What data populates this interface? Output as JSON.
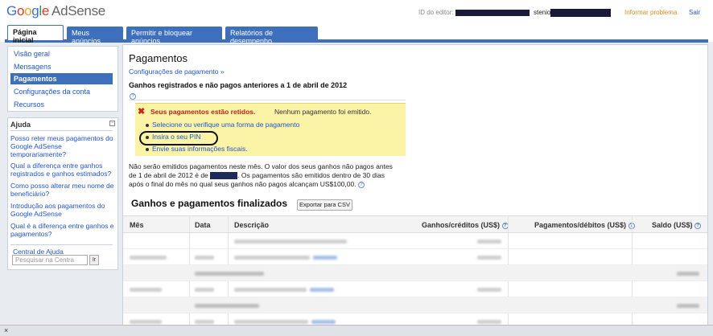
{
  "header": {
    "logo_google": [
      "G",
      "o",
      "o",
      "g",
      "l",
      "e"
    ],
    "logo_product": "AdSense",
    "publisher_label": "ID do editor:",
    "user_prefix": "stenio",
    "report_problem": "Informar problema",
    "logout": "Sair"
  },
  "tabs": [
    {
      "label": "Página inicial",
      "active": true
    },
    {
      "label": "Meus anúncios"
    },
    {
      "label": "Permitir e bloquear anúncios"
    },
    {
      "label": "Relatórios de desempenho"
    }
  ],
  "sidebar": {
    "items": [
      {
        "label": "Visão geral"
      },
      {
        "label": "Mensagens"
      },
      {
        "label": "Pagamentos",
        "selected": true
      },
      {
        "label": "Configurações da conta"
      },
      {
        "label": "Recursos"
      }
    ],
    "help": {
      "title": "Ajuda",
      "toggle": "−",
      "links": [
        "Posso reter meus pagamentos do Google AdSense temporariamente?",
        "Qual a diferença entre ganhos registrados e ganhos estimados?",
        "Como posso alterar meu nome de beneficiário?",
        "Introdução aos pagamentos do Google AdSense",
        "Qual é a diferença entre ganhos e pagamentos?"
      ],
      "help_center": "Central de Ajuda",
      "search_placeholder": "Pesquisar na Centra",
      "search_button": "Ir"
    }
  },
  "main": {
    "title": "Pagamentos",
    "config_link": "Configurações de pagamento »",
    "earnings_heading": "Ganhos registrados e não pagos anteriores a 1 de abril de 2012",
    "help_icon": "?",
    "warning": {
      "icon": "✖",
      "title": "Seus pagamentos estão retidos.",
      "rest": "Nenhum pagamento foi emitido.",
      "links": [
        "Selecione ou verifique uma forma de pagamento",
        "Insira o seu PIN",
        "Envie suas informações fiscais."
      ]
    },
    "notice_line1": "Não serão emitidos pagamentos neste mês. O valor dos seus ganhos não pagos antes",
    "notice_line2a": "de 1 de abril de 2012 é de",
    "notice_line2b": ". Os pagamentos são emitidos dentro de 30 dias",
    "notice_line3": "após o final do mês no qual seus ganhos não pagos alcançam US$100,00.",
    "final_heading": "Ganhos e pagamentos finalizados",
    "export_button": "Exportar para CSV",
    "table": {
      "columns": [
        "Mês",
        "Data",
        "Descrição",
        "Ganhos/créditos (US$)",
        "Pagamentos/débitos (US$)",
        "Saldo (US$)"
      ]
    }
  },
  "bottom": {
    "close": "×"
  }
}
